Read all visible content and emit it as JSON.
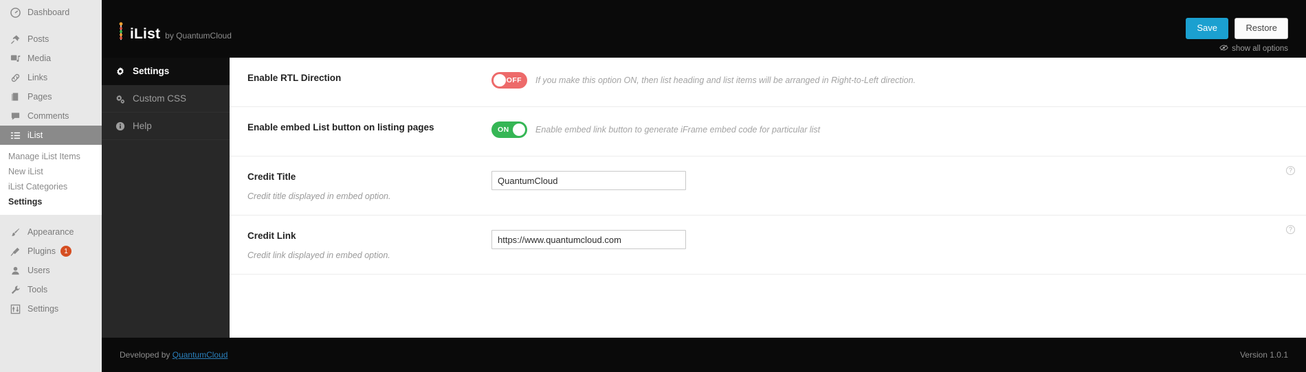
{
  "wp_sidebar": {
    "items": [
      {
        "label": "Dashboard",
        "icon": "dashboard-icon"
      },
      {
        "label": "Posts",
        "icon": "pin-icon"
      },
      {
        "label": "Media",
        "icon": "media-icon"
      },
      {
        "label": "Links",
        "icon": "link-icon"
      },
      {
        "label": "Pages",
        "icon": "pages-icon"
      },
      {
        "label": "Comments",
        "icon": "comments-icon"
      },
      {
        "label": "iList",
        "icon": "list-icon"
      },
      {
        "label": "Appearance",
        "icon": "brush-icon"
      },
      {
        "label": "Plugins",
        "icon": "plug-icon",
        "badge": "1"
      },
      {
        "label": "Users",
        "icon": "user-icon"
      },
      {
        "label": "Tools",
        "icon": "wrench-icon"
      },
      {
        "label": "Settings",
        "icon": "sliders-icon"
      }
    ],
    "submenu": [
      {
        "label": "Manage iList Items"
      },
      {
        "label": "New iList"
      },
      {
        "label": "iList Categories"
      },
      {
        "label": "Settings"
      }
    ]
  },
  "header": {
    "brand_name": "iList",
    "brand_by": "by QuantumCloud",
    "save_label": "Save",
    "restore_label": "Restore",
    "show_all_label": "show all options",
    "accent_color": "#1ba0d0"
  },
  "tabs": [
    {
      "label": "Settings",
      "icon": "gear-icon"
    },
    {
      "label": "Custom CSS",
      "icon": "gears-icon"
    },
    {
      "label": "Help",
      "icon": "info-icon"
    }
  ],
  "options": [
    {
      "title": "Enable RTL Direction",
      "toggle_state": "OFF",
      "description": "If you make this option ON, then list heading and list items will be arranged in Right-to-Left direction."
    },
    {
      "title": "Enable embed List button on listing pages",
      "toggle_state": "ON",
      "description": "Enable embed link button to generate iFrame embed code for particular list"
    },
    {
      "title": "Credit Title",
      "subtitle": "Credit title displayed in embed option.",
      "value": "QuantumCloud",
      "help": "?"
    },
    {
      "title": "Credit Link",
      "subtitle": "Credit link displayed in embed option.",
      "value": "https://www.quantumcloud.com",
      "help": "?"
    }
  ],
  "footer": {
    "developed_by": "Developed by",
    "developer": "QuantumCloud",
    "version": "Version 1.0.1"
  }
}
